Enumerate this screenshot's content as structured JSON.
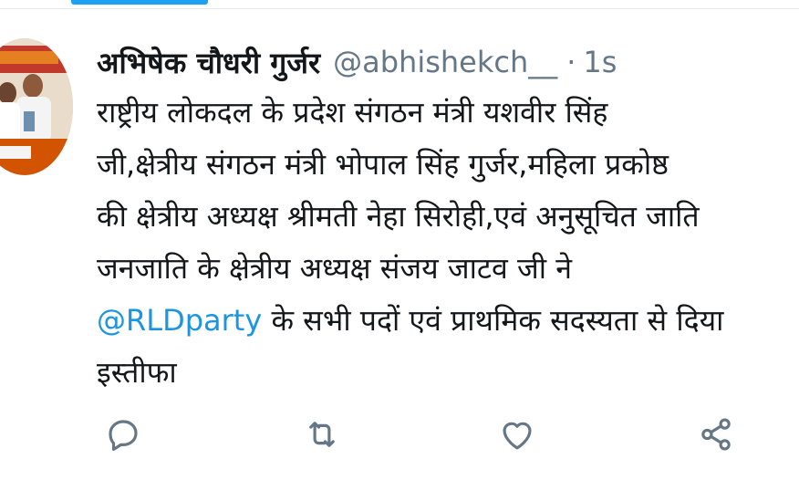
{
  "tweet": {
    "author": {
      "display_name": "अभिषेक चौधरी गुर्जर",
      "handle": "@abhishekch__",
      "separator": "·",
      "timestamp": "1s"
    },
    "body": {
      "line1": "राष्ट्रीय लोकदल के प्रदेश संगठन मंत्री यशवीर सिंह",
      "line2": "जी,क्षेत्रीय संगठन मंत्री भोपाल सिंह गुर्जर,महिला प्रकोष्ठ",
      "line3": "की क्षेत्रीय अध्यक्ष श्रीमती नेहा सिरोही,एवं अनुसूचित जाति",
      "line4": "जनजाति के क्षेत्रीय अध्यक्ष संजय जाटव जी ने",
      "line5_mention": "@RLDparty",
      "line5_rest": " के सभी पदों एवं प्राथमिक सदस्यता से दिया",
      "line6": "इस्तीफा"
    },
    "actions": {
      "reply_icon": "reply-icon",
      "retweet_icon": "retweet-icon",
      "like_icon": "heart-icon",
      "share_icon": "share-icon"
    }
  },
  "colors": {
    "text": "#14171a",
    "muted": "#657786",
    "link": "#1b95e0",
    "accent": "#1da1f2",
    "divider": "#e1e8ed"
  }
}
